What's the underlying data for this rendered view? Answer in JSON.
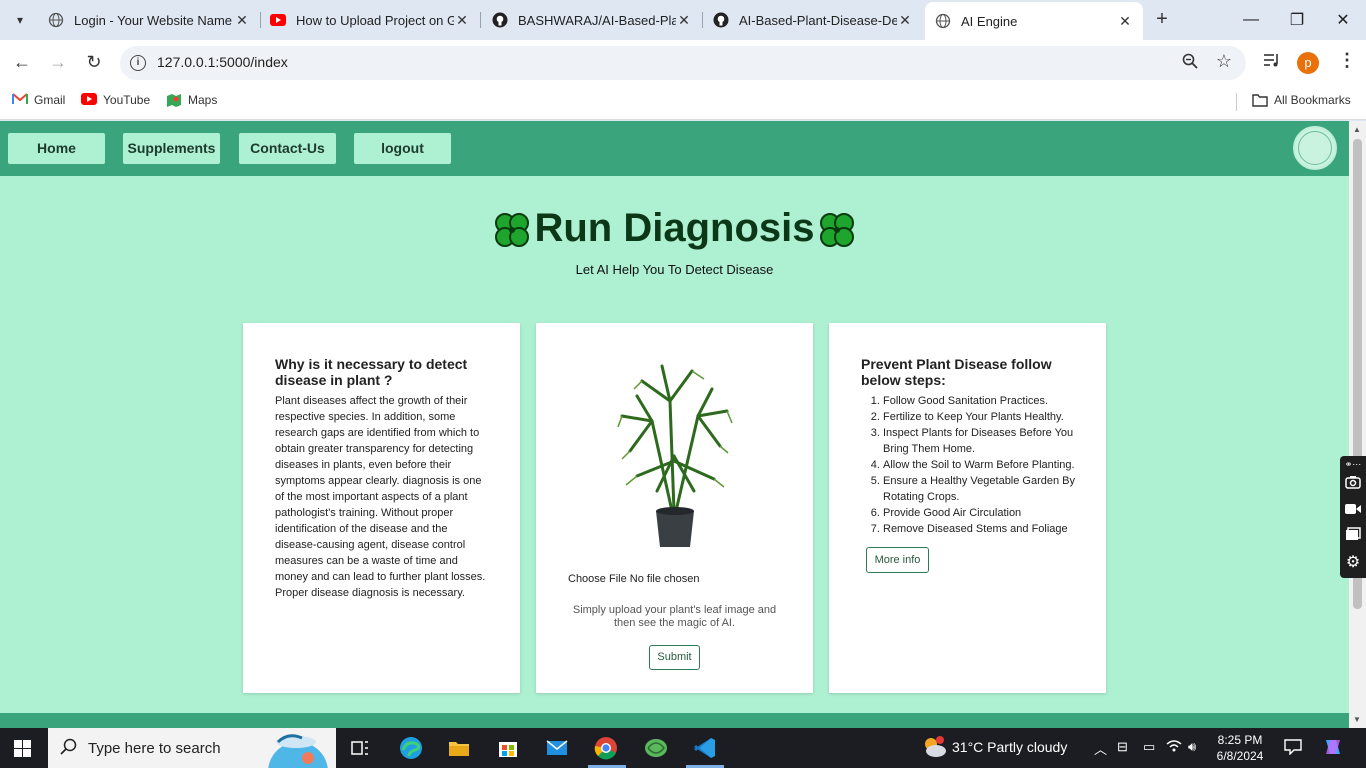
{
  "browser": {
    "tabs": [
      {
        "title": "Login - Your Website Name",
        "favicon": "globe-icon",
        "active": false
      },
      {
        "title": "How to Upload Project on Gi",
        "favicon": "youtube-icon",
        "active": false
      },
      {
        "title": "BASHWARAJ/AI-Based-Plant",
        "favicon": "github-icon",
        "active": false
      },
      {
        "title": "AI-Based-Plant-Disease-Dete",
        "favicon": "github-icon",
        "active": false
      },
      {
        "title": "AI Engine",
        "favicon": "globe-icon",
        "active": true
      }
    ],
    "url": "127.0.0.1:5000/index",
    "profile_initial": "p",
    "bookmarks": [
      {
        "label": "Gmail",
        "icon": "gmail-icon"
      },
      {
        "label": "YouTube",
        "icon": "youtube-icon"
      },
      {
        "label": "Maps",
        "icon": "maps-icon"
      }
    ],
    "all_bookmarks": "All Bookmarks"
  },
  "site": {
    "nav": [
      "Home",
      "Supplements",
      "Contact-Us",
      "logout"
    ],
    "colors": {
      "nav_bg": "#3aa57c",
      "page_bg": "#adf0d2",
      "heading": "#0c3818"
    },
    "heading": "Run Diagnosis",
    "subheading": "Let AI Help You To Detect Disease",
    "card_left": {
      "title": "Why is it necessary to detect disease in plant ?",
      "body": "Plant diseases affect the growth of their respective species. In addition, some research gaps are identified from which to obtain greater transparency for detecting diseases in plants, even before their symptoms appear clearly. diagnosis is one of the most important aspects of a plant pathologist's training. Without proper identification of the disease and the disease-causing agent, disease control measures can be a waste of time and money and can lead to further plant losses. Proper disease diagnosis is necessary."
    },
    "card_center": {
      "file_button": "Choose File",
      "file_status": "No file chosen",
      "hint": "Simply upload your plant's leaf image and then see the magic of AI.",
      "submit": "Submit"
    },
    "card_right": {
      "title": "Prevent Plant Disease follow below steps:",
      "steps": [
        "Follow Good Sanitation Practices.",
        "Fertilize to Keep Your Plants Healthy.",
        "Inspect Plants for Diseases Before You Bring Them Home.",
        "Allow the Soil to Warm Before Planting.",
        "Ensure a Healthy Vegetable Garden By Rotating Crops.",
        "Provide Good Air Circulation",
        "Remove Diseased Stems and Foliage"
      ],
      "more": "More info"
    }
  },
  "taskbar": {
    "search_placeholder": "Type here to search",
    "weather": "31°C  Partly cloudy",
    "time": "8:25 PM",
    "date": "6/8/2024"
  }
}
